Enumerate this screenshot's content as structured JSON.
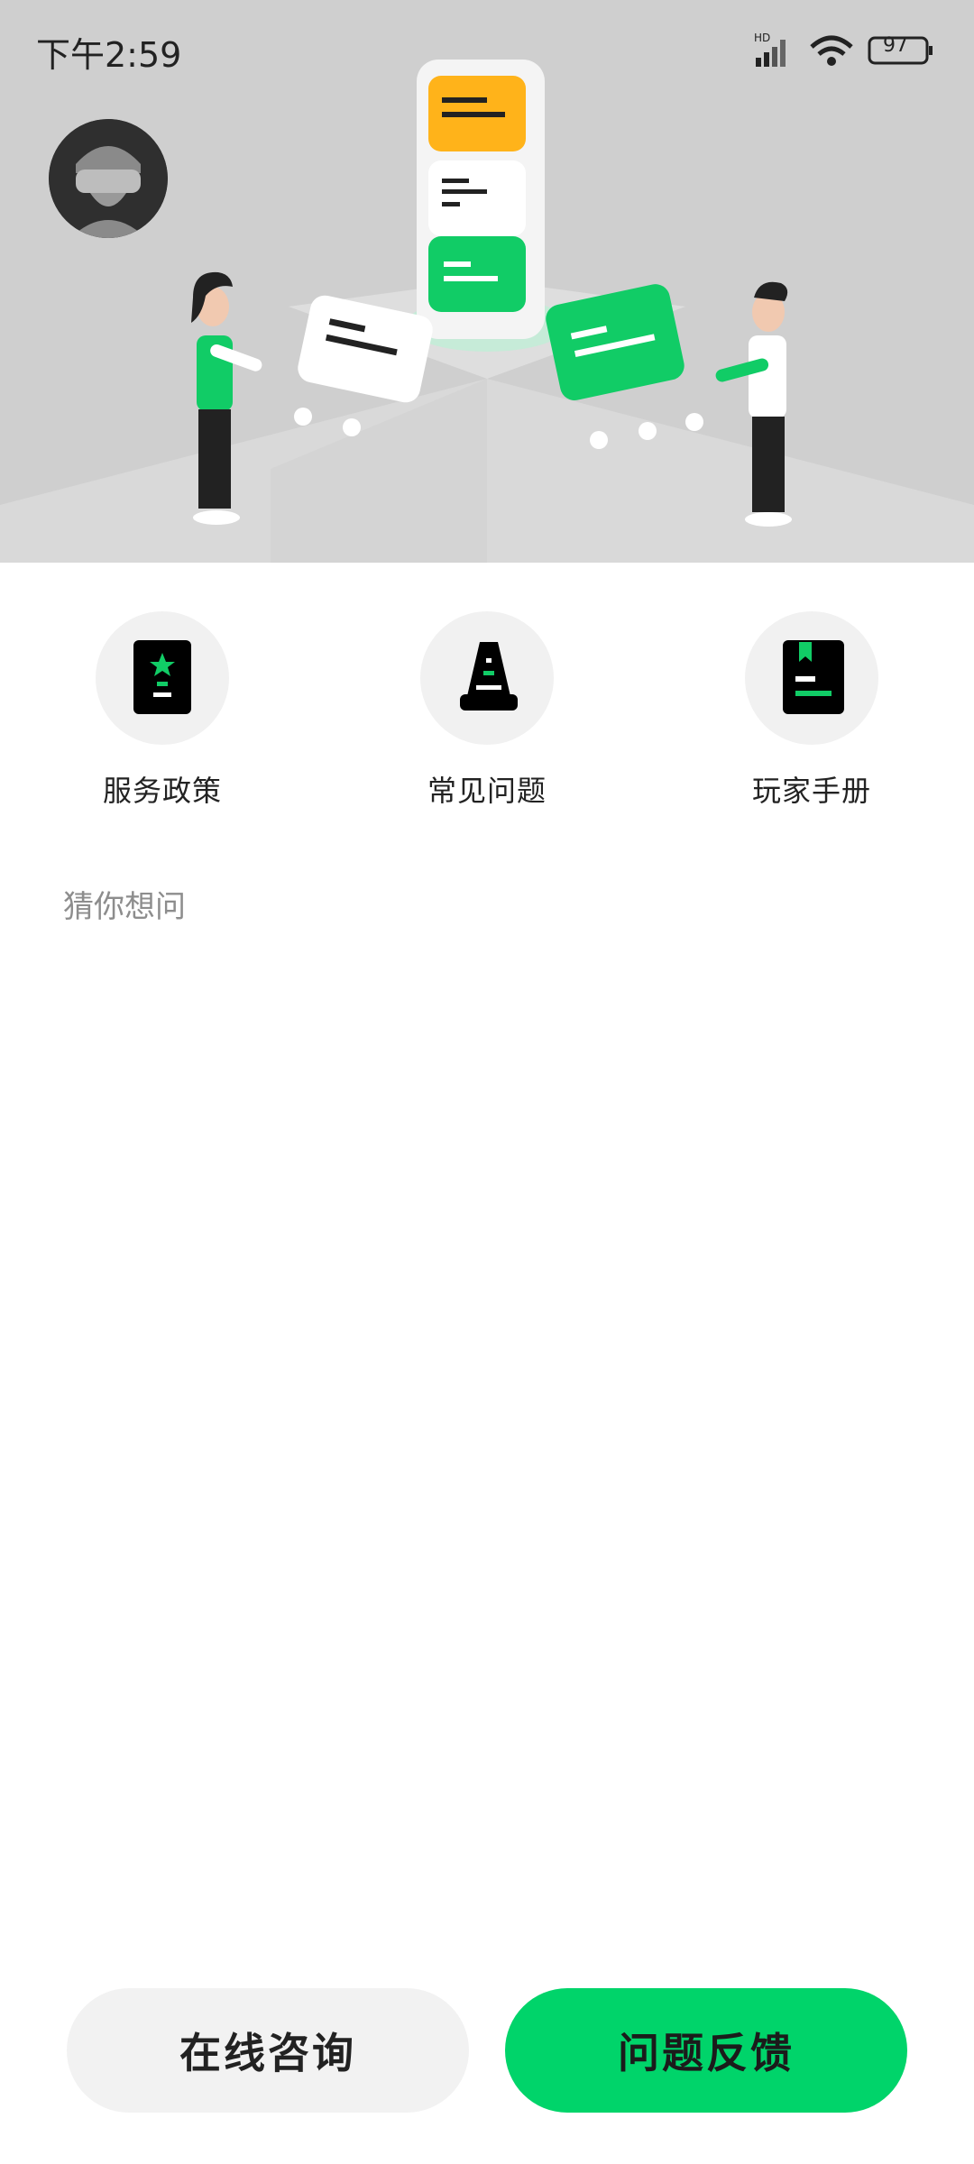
{
  "status_bar": {
    "time": "下午2:59",
    "signal_label": "HD",
    "battery": "97",
    "icons": [
      "signal-icon",
      "wifi-icon",
      "battery-icon"
    ]
  },
  "header": {
    "illustration": "customer-service-illustration",
    "avatar": "user-avatar"
  },
  "quick_entries": [
    {
      "label": "服务政策",
      "icon": "policy-book-icon"
    },
    {
      "label": "常见问题",
      "icon": "faq-cone-icon"
    },
    {
      "label": "玩家手册",
      "icon": "manual-book-icon"
    }
  ],
  "guess": {
    "title": "猜你想问"
  },
  "actions": {
    "consult": "在线咨询",
    "feedback": "问题反馈"
  },
  "colors": {
    "accent": "#00d46a",
    "orange": "#ffb31a",
    "hero_bg": "#cfcfcf"
  }
}
